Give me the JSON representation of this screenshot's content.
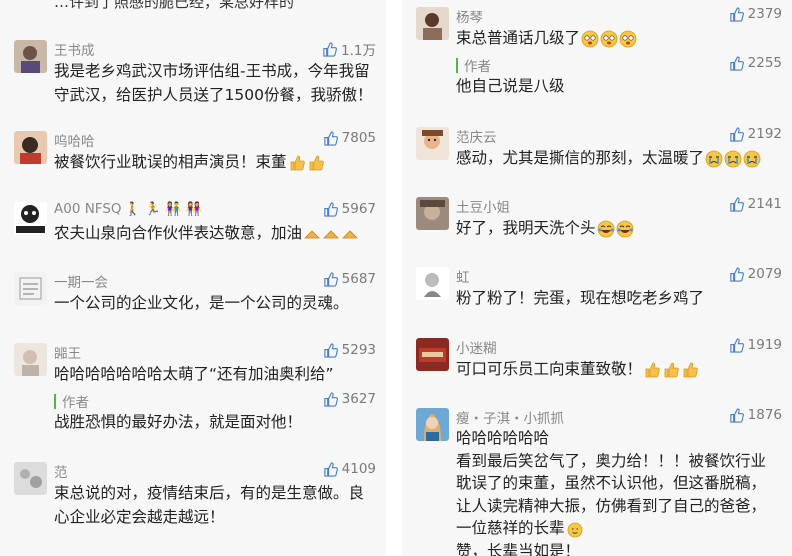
{
  "left": {
    "cut_top_text": "…许到了照感的脆已经，某总好样的",
    "comments": [
      {
        "user": "王书成",
        "likes": "1.1万",
        "text": "我是老乡鸡武汉市场评估组-王书成，今年我留守武汉，给医护人员送了1500份餐，我骄傲！"
      },
      {
        "user": "呜哈哈",
        "likes": "7805",
        "text": "被餐饮行业耽误的相声演员！束董"
      },
      {
        "user": "A00 NFSQ",
        "likes": "5967",
        "text": "农夫山泉向合作伙伴表达敬意，加油"
      },
      {
        "user": "一期一会",
        "likes": "5687",
        "text": "一个公司的企业文化，是一个公司的灵魂。"
      },
      {
        "user": "嘂王",
        "likes": "5293",
        "text": "哈哈哈哈哈哈哈太萌了“还有加油奥利给”",
        "reply": {
          "author": "作者",
          "likes": "3627",
          "text": "战胜恐惧的最好办法，就是面对他！"
        }
      },
      {
        "user": "范",
        "likes": "4109",
        "text": "束总说的对，疫情结束后，有的是生意做。良心企业必定会越走越远！"
      }
    ]
  },
  "right": {
    "comments": [
      {
        "user": "杨琴",
        "likes": "2379",
        "text": "束总普通话几级了",
        "reply": {
          "author": "作者",
          "likes": "2255",
          "text": "他自己说是八级"
        }
      },
      {
        "user": "范庆云",
        "likes": "2192",
        "text": "感动，尤其是撕信的那刻，太温暖了"
      },
      {
        "user": "土豆小姐",
        "likes": "2141",
        "text": "好了，我明天洗个头"
      },
      {
        "user": "虹",
        "likes": "2079",
        "text": "粉了粉了！完蛋，现在想吃老乡鸡了"
      },
      {
        "user": "小迷糊",
        "likes": "1919",
        "text": "可口可乐员工向束董致敬！"
      },
      {
        "user": "瘦・子淇・小抓抓",
        "likes": "1876",
        "lines": [
          "哈哈哈哈哈哈",
          "看到最后笑岔气了，奥力给！！！被餐饮行业",
          "耽误了的束董，虽然不认识他，但这番脱稿，",
          "让人读完精神大振，仿佛看到了自己的爸爸，",
          "一位慈祥的长辈",
          "赞，长辈当如是！"
        ]
      }
    ]
  },
  "colors": {
    "panel_bg": "#f7f7f7",
    "author_bar": "#52b54a",
    "like_icon": "#4a7fc8"
  }
}
